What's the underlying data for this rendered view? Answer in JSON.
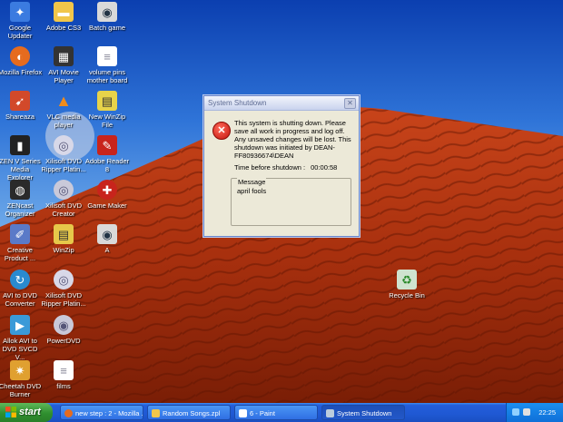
{
  "desktop_icons": [
    {
      "label": "Google Updater",
      "icon": "google-updater-icon",
      "color": "#3b7be0"
    },
    {
      "label": "Adobe CS3",
      "icon": "folder-icon",
      "color": "#f1c64a"
    },
    {
      "label": "Batch game",
      "icon": "game-window-icon",
      "color": "#d9d9d9"
    },
    {
      "label": "Mozilla Firefox",
      "icon": "firefox-icon",
      "color": "#e66b1e"
    },
    {
      "label": "AVI Movie Player",
      "icon": "film-icon",
      "color": "#333333"
    },
    {
      "label": "volume pins mother board",
      "icon": "document-icon",
      "color": "#ffffff"
    },
    {
      "label": "Shareaza",
      "icon": "shareaza-icon",
      "color": "#d2492a"
    },
    {
      "label": "VLC media player",
      "icon": "vlc-cone-icon",
      "color": "#f08c1c"
    },
    {
      "label": "New WinZip File",
      "icon": "winzip-icon",
      "color": "#e6d34a"
    },
    {
      "label": "ZEN V Series Media Explorer",
      "icon": "zen-player-icon",
      "color": "#222222"
    },
    {
      "label": "Xilisoft DVD Ripper Platin...",
      "icon": "dvd-disc-icon",
      "color": "#d8d8e8"
    },
    {
      "label": "Adobe Reader 8",
      "icon": "pdf-icon",
      "color": "#c8241c"
    },
    {
      "label": "ZENcast Organizer",
      "icon": "podcast-icon",
      "color": "#2a2a2a"
    },
    {
      "label": "Xilisoft DVD Creator",
      "icon": "dvd-creator-icon",
      "color": "#c9c9d9"
    },
    {
      "label": "Game Maker",
      "icon": "game-maker-icon",
      "color": "#c8241c"
    },
    {
      "label": "Creative Product ...",
      "icon": "creative-icon",
      "color": "#5a7ac8"
    },
    {
      "label": "WinZip",
      "icon": "winzip-icon",
      "color": "#e6c84a"
    },
    {
      "label": "A",
      "icon": "game-window-icon",
      "color": "#d9d9d9"
    },
    {
      "label": "AVI to DVD Converter",
      "icon": "converter-icon",
      "color": "#2a8ad0"
    },
    {
      "label": "Xilisoft DVD Ripper Platin...",
      "icon": "dvd-disc-icon",
      "color": "#d8d8e8"
    },
    {
      "label": "Allok AVI to DVD SVCD V...",
      "icon": "allok-icon",
      "color": "#3a9ad8"
    },
    {
      "label": "PowerDVD",
      "icon": "powerdvd-icon",
      "color": "#c9c9d9"
    },
    {
      "label": "Cheetah DVD Burner",
      "icon": "cheetah-icon",
      "color": "#e0a030"
    },
    {
      "label": "films",
      "icon": "document-icon",
      "color": "#ffffff"
    }
  ],
  "recycle_bin": {
    "label": "Recycle Bin",
    "icon": "recycle-bin-icon"
  },
  "dialog": {
    "title": "System Shutdown",
    "close_label": "✕",
    "message": "This system is shutting down. Please save all work in progress and log off. Any unsaved changes will be lost. This shutdown was initiated by DEAN-FF80936674\\DEAN",
    "timer_label": "Time before shutdown :",
    "timer_value": "00:00:58",
    "message_group_label": "Message",
    "message_content": "april fools"
  },
  "taskbar": {
    "start_label": "start",
    "buttons": [
      {
        "label": "new step : 2 - Mozilla ...",
        "icon": "firefox-icon",
        "color": "#e66b1e",
        "active": false
      },
      {
        "label": "Random Songs.zpl",
        "icon": "folder-icon",
        "color": "#f1c64a",
        "active": false
      },
      {
        "label": "6 - Paint",
        "icon": "paint-icon",
        "color": "#ffffff",
        "active": false
      },
      {
        "label": "System Shutdown",
        "icon": "window-icon",
        "color": "#bcd",
        "active": true
      }
    ],
    "clock": "22:25"
  }
}
